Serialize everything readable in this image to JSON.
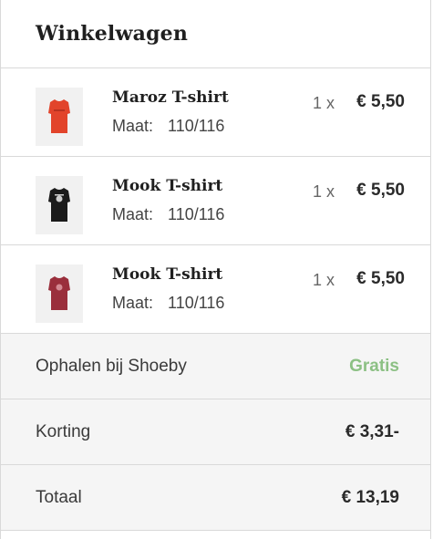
{
  "cart": {
    "title": "Winkelwagen",
    "items": [
      {
        "name": "Maroz T-shirt",
        "size_label": "Maat:",
        "size": "110/116",
        "qty": "1 x",
        "price": "€ 5,50",
        "thumb_color": "#e2442b"
      },
      {
        "name": "Mook T-shirt",
        "size_label": "Maat:",
        "size": "110/116",
        "qty": "1 x",
        "price": "€ 5,50",
        "thumb_color": "#1b1b1b"
      },
      {
        "name": "Mook T-shirt",
        "size_label": "Maat:",
        "size": "110/116",
        "qty": "1 x",
        "price": "€ 5,50",
        "thumb_color": "#9a2f3c"
      }
    ],
    "summary": {
      "shipping_label": "Ophalen bij Shoeby",
      "shipping_value": "Gratis",
      "discount_label": "Korting",
      "discount_value": "€ 3,31-",
      "total_label": "Totaal",
      "total_value": "€ 13,19"
    },
    "colors": {
      "free_green": "#8cc084",
      "divider": "#d9d9d9",
      "summary_bg": "#f5f5f5"
    }
  }
}
